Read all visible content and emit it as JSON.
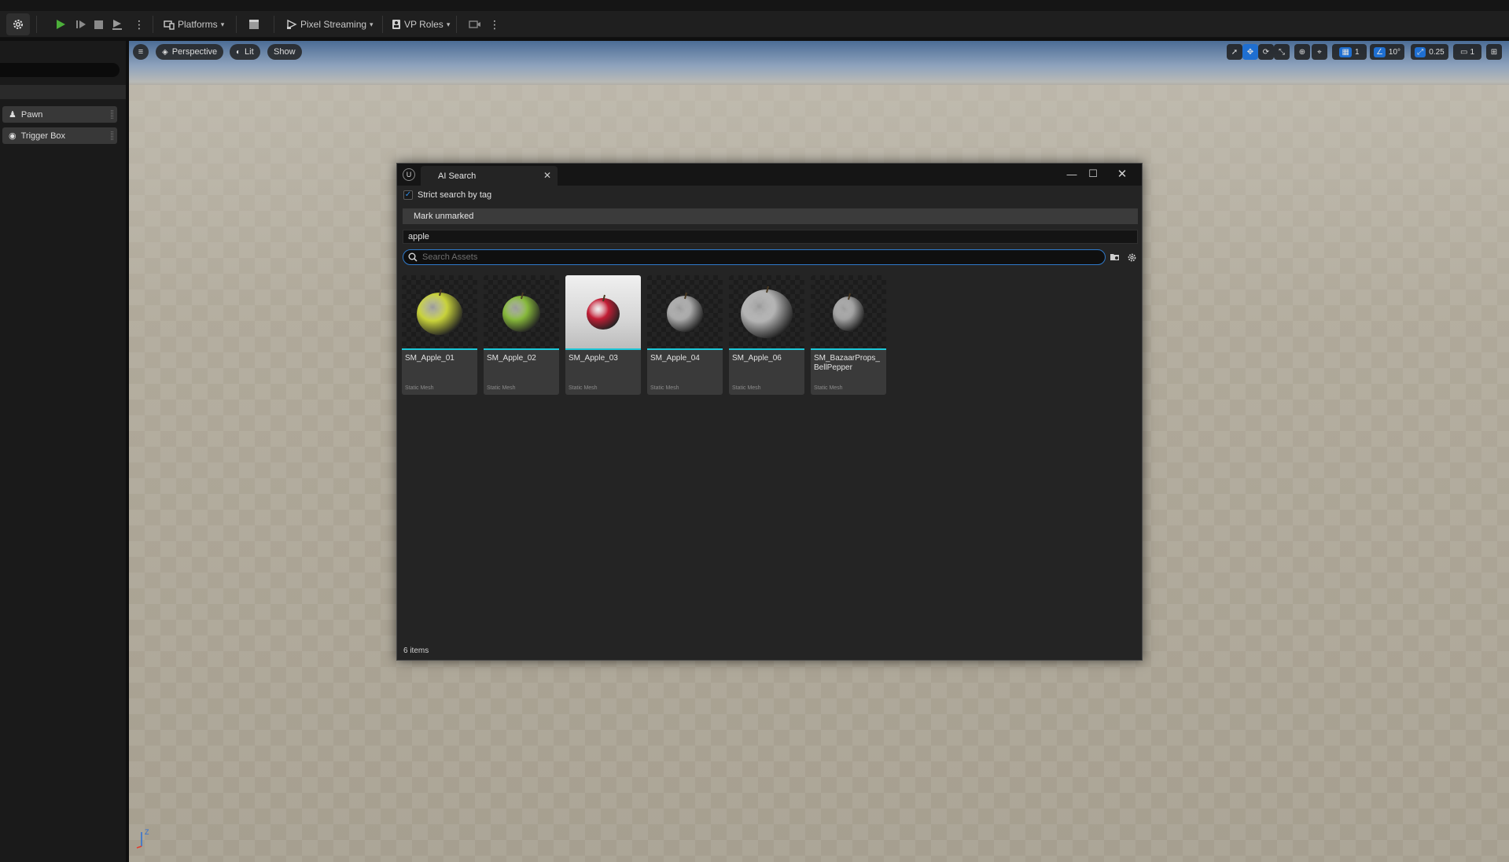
{
  "toolbar": {
    "platforms_label": "Platforms",
    "pixel_streaming_label": "Pixel Streaming",
    "vp_roles_label": "VP Roles"
  },
  "outliner": {
    "items": [
      {
        "label": "Pawn",
        "icon": "pawn-icon"
      },
      {
        "label": "Trigger Box",
        "icon": "trigger-box-icon"
      }
    ]
  },
  "viewport": {
    "perspective_label": "Perspective",
    "lit_label": "Lit",
    "show_label": "Show",
    "grid_snap_value": "1",
    "rotation_snap_value": "10°",
    "scale_snap_value": "0.25",
    "camera_speed_value": "1",
    "axis_z": "Z"
  },
  "dialog": {
    "tab_title": "AI Search",
    "strict_search_label": "Strict search by tag",
    "strict_search_checked": true,
    "mark_unmarked_label": "Mark unmarked",
    "tag_value": "apple",
    "search_placeholder": "Search Assets",
    "item_count": "6 items",
    "assets": [
      {
        "name": "SM_Apple_01",
        "type": "Static Mesh",
        "color": "#c8d23a",
        "studio": false
      },
      {
        "name": "SM_Apple_02",
        "type": "Static Mesh",
        "color": "#86b83a",
        "studio": false
      },
      {
        "name": "SM_Apple_03",
        "type": "Static Mesh",
        "color": "#c21d35",
        "studio": true
      },
      {
        "name": "SM_Apple_04",
        "type": "Static Mesh",
        "color": "#a9a9a9",
        "studio": false
      },
      {
        "name": "SM_Apple_06",
        "type": "Static Mesh",
        "color": "#b3b3b3",
        "studio": false
      },
      {
        "name": "SM_BazaarProps_BellPepper",
        "type": "Static Mesh",
        "color": "#a0a0a0",
        "studio": false
      }
    ]
  }
}
